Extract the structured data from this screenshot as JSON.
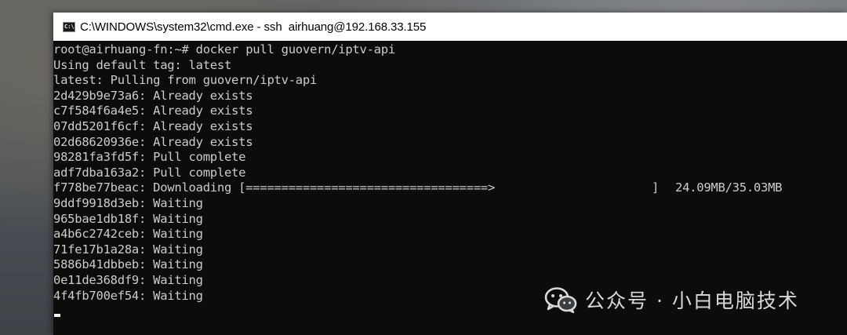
{
  "window": {
    "title": "C:\\WINDOWS\\system32\\cmd.exe - ssh  airhuang@192.168.33.155",
    "icon": "cmd-console-icon",
    "icon_glyph": "C:\\"
  },
  "terminal": {
    "lines": [
      "root@airhuang-fn:~# docker pull guovern/iptv-api",
      "Using default tag: latest",
      "latest: Pulling from guovern/iptv-api",
      "2d429b9e73a6: Already exists",
      "c7f584f6a4e5: Already exists",
      "07dd5201f6cf: Already exists",
      "02d68620936e: Already exists",
      "98281fa3fd5f: Pull complete",
      "adf7dba163a2: Pull complete",
      "",
      "9ddf9918d3eb: Waiting",
      "965bae1db18f: Waiting",
      "a4b6c2742ceb: Waiting",
      "71fe17b1a28a: Waiting",
      "5886b41dbbeb: Waiting",
      "0e11de368df9: Waiting",
      "4f4fb700ef54: Waiting"
    ],
    "download_line": {
      "prefix": "f778be77beac: Downloading [==================================>",
      "close_bracket": "]",
      "size": "24.09MB/35.03MB",
      "progress_fraction": 0.688
    },
    "cursor_visible": true
  },
  "watermark": {
    "text": "公众号 · 小白电脑技术",
    "icon": "wechat-icon"
  }
}
